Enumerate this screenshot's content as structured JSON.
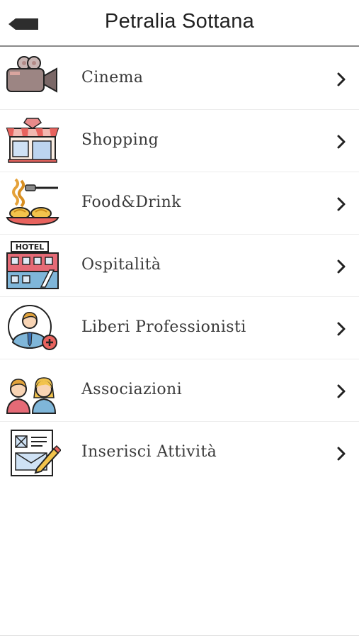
{
  "header": {
    "title": "Petralia Sottana",
    "back_icon": "back-arrow-icon"
  },
  "menu": {
    "items": [
      {
        "label": "Cinema",
        "icon": "movie-camera-icon"
      },
      {
        "label": "Shopping",
        "icon": "shop-storefront-icon"
      },
      {
        "label": "Food&Drink",
        "icon": "spaghetti-fork-icon"
      },
      {
        "label": "Ospitalità",
        "icon": "hotel-building-icon"
      },
      {
        "label": "Liberi Professionisti",
        "icon": "professional-add-icon"
      },
      {
        "label": "Associazioni",
        "icon": "people-group-icon"
      },
      {
        "label": "Inserisci Attività",
        "icon": "form-edit-icon"
      }
    ]
  },
  "icon_texts": {
    "hotel_sign": "HOTEL"
  },
  "colors": {
    "chevron": "#222222",
    "label": "#3a3a3a",
    "header_border": "#8a8a8a"
  }
}
